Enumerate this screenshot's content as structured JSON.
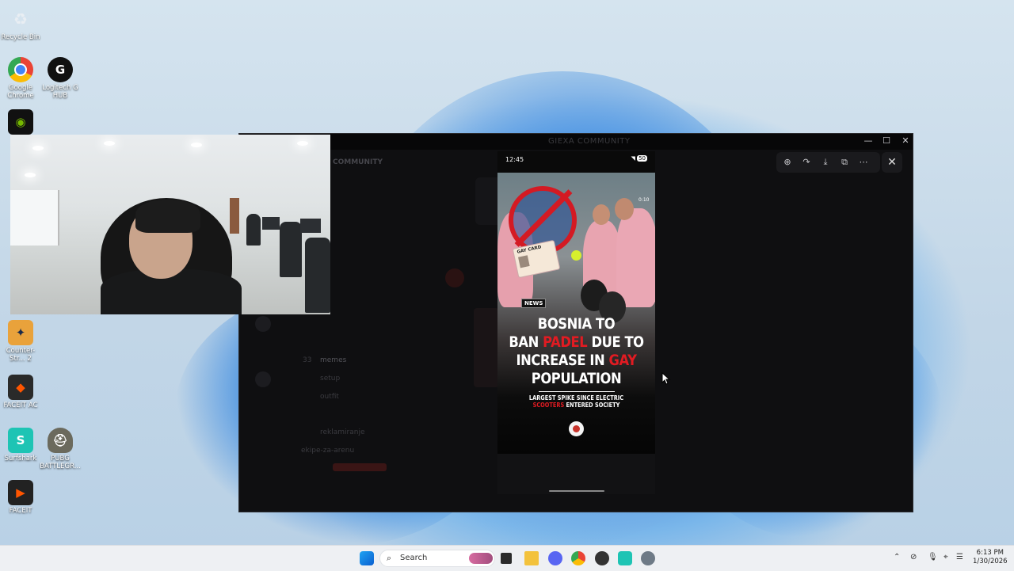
{
  "desktop": {
    "icons": [
      {
        "label": "Recycle Bin",
        "icon": "recycle-bin-icon"
      },
      {
        "label": "Google Chrome",
        "icon": "chrome-icon"
      },
      {
        "label": "Logitech G HUB",
        "icon": "logitech-icon"
      },
      {
        "label": "NV",
        "icon": "nvidia-icon"
      },
      {
        "label": "Counter-Str... 2",
        "icon": "counter-strike-icon"
      },
      {
        "label": "FACEIT AC",
        "icon": "faceit-ac-icon"
      },
      {
        "label": "Surfshark",
        "icon": "surfshark-icon"
      },
      {
        "label": "PUBG BATTLEGR...",
        "icon": "pubg-icon"
      },
      {
        "label": "FACEIT",
        "icon": "faceit-icon"
      }
    ]
  },
  "discord": {
    "window_title": "GIEXA COMMUNITY",
    "server_name": "COMMUNITY",
    "channels": [
      "memes",
      "setup",
      "outfit",
      "reklamiranje",
      "ekipe-za-arenu"
    ],
    "badge_count": "33"
  },
  "viewer": {
    "phone_time": "12:45",
    "battery": "50",
    "post": {
      "news_tag": "NEWS",
      "headline_line1": "BOSNIA TO",
      "headline_ban": "BAN ",
      "headline_padel": "PADEL",
      "headline_due": " DUE TO",
      "headline_line3a": "INCREASE IN ",
      "headline_gay": "GAY",
      "headline_line4": "POPULATION",
      "sub_line1": "LARGEST SPIKE SINCE ELECTRIC",
      "sub_scooters": "SCOOTERS",
      "sub_line2b": " ENTERED SOCIETY",
      "card_title": "GAY CARD",
      "reel_timer": "0:10"
    }
  },
  "taskbar": {
    "search_placeholder": "Search",
    "time": "6:13 PM",
    "date": "1/30/2026"
  }
}
